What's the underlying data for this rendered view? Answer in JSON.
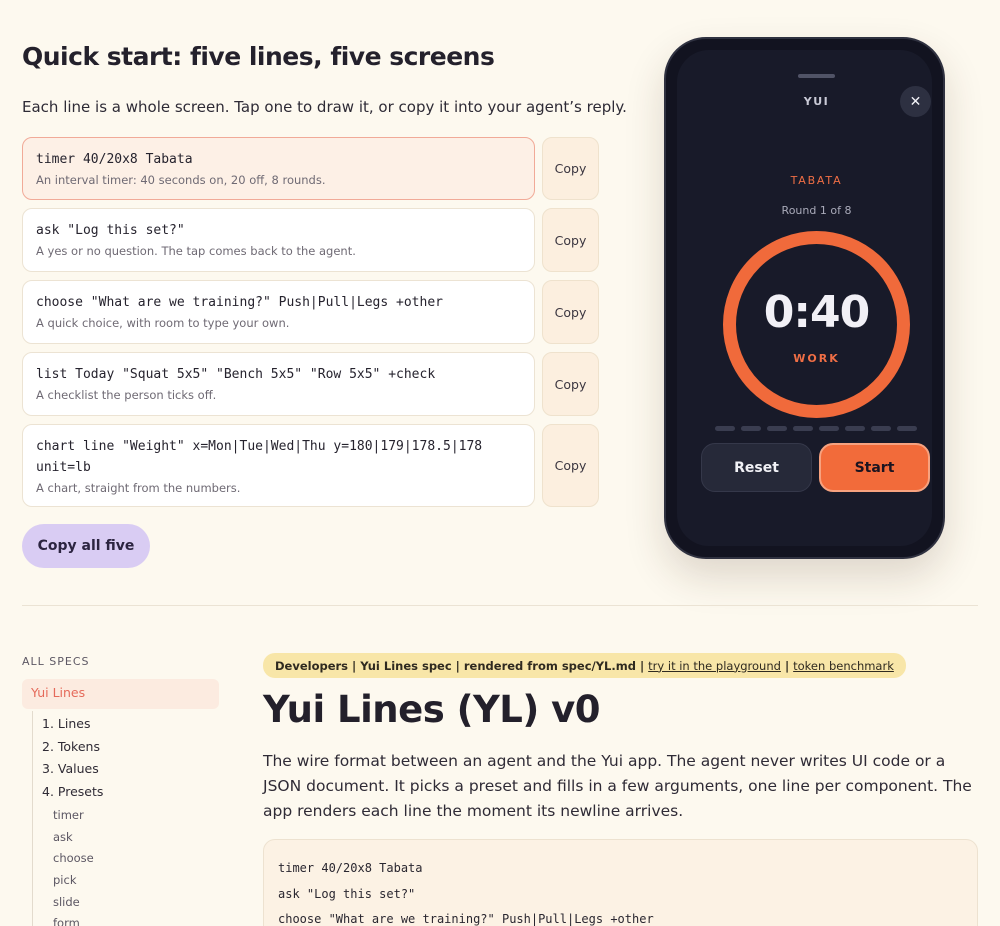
{
  "quickstart": {
    "title": "Quick start: five lines, five screens",
    "intro": "Each line is a whole screen. Tap one to draw it, or copy it into your agent’s reply.",
    "lines": [
      {
        "code": "timer 40/20x8 Tabata",
        "desc": "An interval timer: 40 seconds on, 20 off, 8 rounds.",
        "copy": "Copy",
        "active": true
      },
      {
        "code": "ask \"Log this set?\"",
        "desc": "A yes or no question. The tap comes back to the agent.",
        "copy": "Copy",
        "active": false
      },
      {
        "code": "choose \"What are we training?\" Push|Pull|Legs +other",
        "desc": "A quick choice, with room to type your own.",
        "copy": "Copy",
        "active": false
      },
      {
        "code": "list Today \"Squat 5x5\" \"Bench 5x5\" \"Row 5x5\" +check",
        "desc": "A checklist the person ticks off.",
        "copy": "Copy",
        "active": false
      },
      {
        "code": "chart line \"Weight\" x=Mon|Tue|Wed|Thu y=180|179|178.5|178 unit=lb",
        "desc": "A chart, straight from the numbers.",
        "copy": "Copy",
        "active": false
      }
    ],
    "copy_all": "Copy all five"
  },
  "phone": {
    "app_name": "YUI",
    "close_icon": "close-icon",
    "close_glyph": "✕",
    "timer_name": "TABATA",
    "round": "Round 1 of 8",
    "time": "0:40",
    "phase": "WORK",
    "round_progress": {
      "current": 1,
      "total": 8
    },
    "reset_label": "Reset",
    "start_label": "Start",
    "accent": "#f26b3a",
    "screen_bg": "#181a29"
  },
  "sidebar": {
    "heading": "ALL SPECS",
    "active": "Yui Lines",
    "items": [
      "1. Lines",
      "2. Tokens",
      "3. Values",
      "4. Presets"
    ],
    "subitems": [
      "timer",
      "ask",
      "choose",
      "pick",
      "slide",
      "form"
    ]
  },
  "doc": {
    "crumbs": {
      "developers": "Developers",
      "spec": "Yui Lines spec",
      "rendered": "rendered from spec/YL.md",
      "sep": "|",
      "playground": "try it in the playground",
      "benchmark": "token benchmark"
    },
    "title": "Yui Lines (YL) v0",
    "intro": "The wire format between an agent and the Yui app. The agent never writes UI code or a JSON document. It picks a preset and fills in a few arguments, one line per component. The app renders each line the moment its newline arrives.",
    "code": [
      "timer 40/20x8 Tabata",
      "ask \"Log this set?\"",
      "choose \"What are we training?\" Push|Pull|Legs +other"
    ]
  },
  "colors": {
    "page_bg": "#fdf9ef",
    "accent_orange": "#f06a3b",
    "copy_all_bg": "#d9ccf3",
    "crumb_bg": "#f8e6a8"
  }
}
